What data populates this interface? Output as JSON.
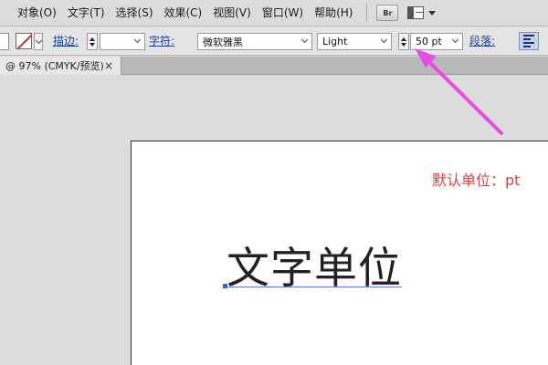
{
  "menu": {
    "items": [
      {
        "label": "对象(O)"
      },
      {
        "label": "文字(T)"
      },
      {
        "label": "选择(S)"
      },
      {
        "label": "效果(C)"
      },
      {
        "label": "视图(V)"
      },
      {
        "label": "窗口(W)"
      },
      {
        "label": "帮助(H)"
      }
    ],
    "bridge_label": "Br"
  },
  "control_bar": {
    "stroke_label": "描边:",
    "stroke_value": "",
    "character_label": "字符:",
    "font_family": "微软雅黑",
    "font_style": "Light",
    "font_size": "50 pt",
    "paragraph_label": "段落:"
  },
  "document_tab": {
    "title": "@ 97% (CMYK/预览)",
    "close": "×"
  },
  "canvas": {
    "annotation": "默认单位：pt",
    "text_object": "文字单位"
  },
  "colors": {
    "annotation": "#e23b3b",
    "arrow": "#e84ce6",
    "selection": "#3a62d9"
  }
}
